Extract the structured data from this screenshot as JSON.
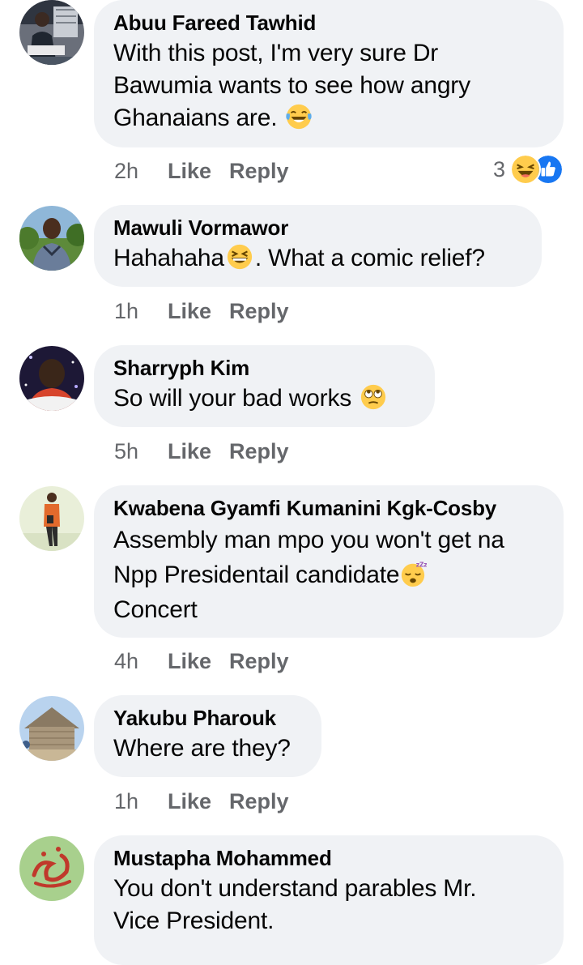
{
  "comments": [
    {
      "author": "Abuu Fareed Tawhid",
      "line1": "With this post, I'm very sure Dr",
      "line2": "Bawumia wants to see how angry",
      "line3": "Ghanaians are.",
      "time": "2h",
      "like": "Like",
      "reply": "Reply",
      "reaction_count": "3",
      "emoji": "laughing-tears-emoji",
      "reactions": [
        "haha-reaction",
        "like-reaction"
      ]
    },
    {
      "author": "Mawuli Vormawor",
      "text_before": "Hahahaha",
      "text_after": ". What a comic relief?",
      "time": "1h",
      "like": "Like",
      "reply": "Reply",
      "emoji": "grinning-squinting-emoji"
    },
    {
      "author": "Sharryph Kim",
      "text": "So will your bad works",
      "time": "5h",
      "like": "Like",
      "reply": "Reply",
      "emoji": "eye-roll-emoji"
    },
    {
      "author": "Kwabena Gyamfi Kumanini Kgk-Cosby",
      "line1": "Assembly man mpo you won't get na",
      "line2": "Npp Presidentail candidate",
      "line3": "Concert",
      "time": "4h",
      "like": "Like",
      "reply": "Reply",
      "emoji": "sleeping-emoji"
    },
    {
      "author": "Yakubu Pharouk",
      "text": "Where are they?",
      "time": "1h",
      "like": "Like",
      "reply": "Reply"
    },
    {
      "author": "Mustapha Mohammed",
      "line1": "You don't understand parables Mr.",
      "line2": "Vice President."
    }
  ],
  "colors": {
    "bubble": "#f0f2f5",
    "meta": "#65676b",
    "text": "#050505",
    "like_blue": "#1877f2",
    "emoji_yellow": "#ffcc4d"
  }
}
